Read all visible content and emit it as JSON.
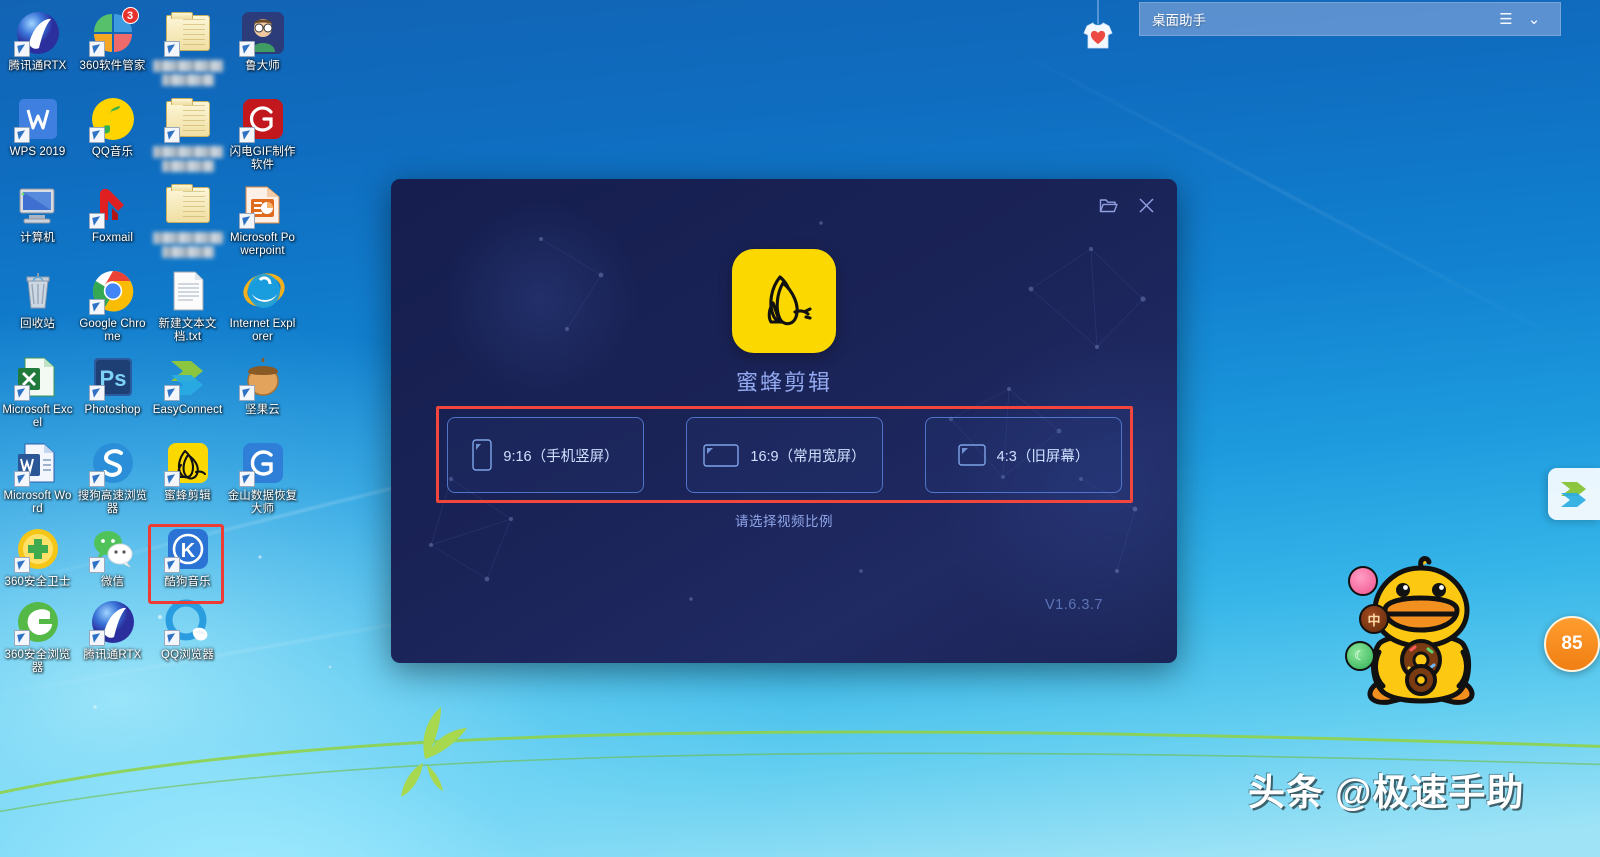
{
  "desktop": {
    "icons": [
      {
        "label": "腾讯通RTX",
        "art": "rtx-icon",
        "shortcut": true,
        "blurred": false
      },
      {
        "label": "360软件管家",
        "art": "360-software-manager-icon",
        "shortcut": true,
        "blurred": false,
        "badge": "3"
      },
      {
        "label": "",
        "art": "folder-icon",
        "shortcut": true,
        "blurred": true
      },
      {
        "label": "鲁大师",
        "art": "ludashi-icon",
        "shortcut": true,
        "blurred": false
      },
      {
        "label": "WPS 2019",
        "art": "wps-icon",
        "shortcut": true,
        "blurred": false
      },
      {
        "label": "QQ音乐",
        "art": "qq-music-icon",
        "shortcut": true,
        "blurred": false
      },
      {
        "label": "",
        "art": "folder-icon",
        "shortcut": true,
        "blurred": true
      },
      {
        "label": "闪电GIF制作软件",
        "art": "gif-maker-icon",
        "shortcut": true,
        "blurred": false
      },
      {
        "label": "计算机",
        "art": "computer-icon",
        "shortcut": false,
        "blurred": false
      },
      {
        "label": "Foxmail",
        "art": "foxmail-icon",
        "shortcut": true,
        "blurred": false
      },
      {
        "label": "",
        "art": "folder-icon",
        "shortcut": false,
        "blurred": true
      },
      {
        "label": "Microsoft Powerpoint",
        "art": "powerpoint-icon",
        "shortcut": true,
        "blurred": false
      },
      {
        "label": "回收站",
        "art": "recycle-bin-icon",
        "shortcut": false,
        "blurred": false
      },
      {
        "label": "Google Chrome",
        "art": "chrome-icon",
        "shortcut": true,
        "blurred": false
      },
      {
        "label": "新建文本文档.txt",
        "art": "text-document-icon",
        "shortcut": false,
        "blurred": false
      },
      {
        "label": "Internet Explorer",
        "art": "internet-explorer-icon",
        "shortcut": false,
        "blurred": false
      },
      {
        "label": "Microsoft Excel",
        "art": "excel-icon",
        "shortcut": true,
        "blurred": false
      },
      {
        "label": "Photoshop",
        "art": "photoshop-icon",
        "shortcut": true,
        "blurred": false
      },
      {
        "label": "EasyConnect",
        "art": "easyconnect-icon",
        "shortcut": true,
        "blurred": false
      },
      {
        "label": "坚果云",
        "art": "nutstore-icon",
        "shortcut": true,
        "blurred": false
      },
      {
        "label": "Microsoft Word",
        "art": "word-icon",
        "shortcut": true,
        "blurred": false
      },
      {
        "label": "搜狗高速浏览器",
        "art": "sogou-browser-icon",
        "shortcut": true,
        "blurred": false
      },
      {
        "label": "蜜蜂剪辑",
        "art": "beecut-icon",
        "shortcut": true,
        "blurred": false,
        "highlighted": true
      },
      {
        "label": "金山数据恢复大师",
        "art": "kingsoft-recovery-icon",
        "shortcut": true,
        "blurred": false
      },
      {
        "label": "360安全卫士",
        "art": "360-safe-guard-icon",
        "shortcut": true,
        "blurred": false
      },
      {
        "label": "微信",
        "art": "wechat-icon",
        "shortcut": true,
        "blurred": false
      },
      {
        "label": "酷狗音乐",
        "art": "kugou-music-icon",
        "shortcut": true,
        "blurred": false
      },
      {
        "label": "",
        "art": "none",
        "shortcut": false,
        "blurred": false
      },
      {
        "label": "360安全浏览器",
        "art": "360-browser-icon",
        "shortcut": true,
        "blurred": false
      },
      {
        "label": "腾讯通RTX",
        "art": "rtx-icon",
        "shortcut": true,
        "blurred": false
      },
      {
        "label": "QQ浏览器",
        "art": "qq-browser-icon",
        "shortcut": true,
        "blurred": false
      },
      {
        "label": "",
        "art": "none",
        "shortcut": false,
        "blurred": false
      }
    ]
  },
  "desk_assistant": {
    "title": "桌面助手",
    "menu_icon": "hamburger-menu-icon",
    "collapse_icon": "chevron-down-icon"
  },
  "shirt_ornament": {
    "icon": "hanging-shirt-icon"
  },
  "beecut": {
    "app_name": "蜜蜂剪辑",
    "logo_icon": "bee-logo-icon",
    "logo_bg": "#fbd900",
    "open_folder_icon": "folder-open-icon",
    "close_icon": "close-icon",
    "hint": "请选择视频比例",
    "version": "V1.6.3.7",
    "highlight_color": "#f2453c",
    "ratios": [
      {
        "label": "9:16（手机竖屏）",
        "icon": "phone-portrait-icon",
        "shape": "portrait"
      },
      {
        "label": "16:9（常用宽屏）",
        "icon": "screen-widescreen-icon",
        "shape": "widescreen"
      },
      {
        "label": "4:3（旧屏幕）",
        "icon": "screen-standard-icon",
        "shape": "standard"
      }
    ]
  },
  "right_dock": {
    "easyconnect_icon": "easyconnect-icon",
    "score_badge": "85"
  },
  "ime_mascot": {
    "name": "sogou-duck-mascot",
    "mini_buttons": [
      {
        "label": "",
        "icon": "donut-icon"
      },
      {
        "label": "中",
        "icon": "chinese-input-mode-icon"
      },
      {
        "label": "",
        "icon": "moon-icon"
      }
    ]
  },
  "watermark": {
    "text": "头条 @极速手助"
  }
}
